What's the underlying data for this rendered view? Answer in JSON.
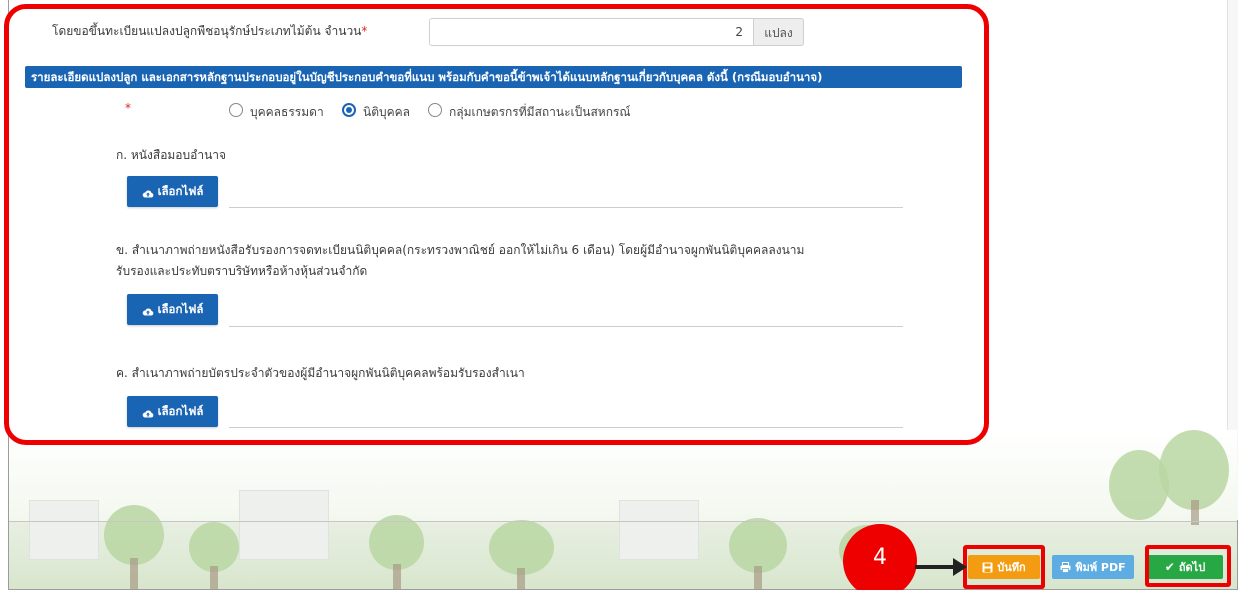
{
  "form": {
    "plot_count_label": "โดยขอขึ้นทะเบียนแปลงปลูกพืชอนุรักษ์ประเภทไม้ต้น จำนวน",
    "required_mark": "*",
    "plot_count_value": "2",
    "plot_count_unit": "แปลง",
    "info_banner": "รายละเอียดแปลงปลูก และเอกสารหลักฐานประกอบอยู่ในบัญชีประกอบคำขอที่แนบ พร้อมกับคำขอนี้ข้าพเจ้าได้แนบหลักฐานเกี่ยวกับบุคคล ดังนี้ (กรณีมอบอำนาจ)",
    "person_type": {
      "required_mark": "*",
      "options": [
        {
          "label": "บุคคลธรรมดา",
          "selected": false
        },
        {
          "label": "นิติบุคคล",
          "selected": true
        },
        {
          "label": "กลุ่มเกษตรกรที่มีสถานะเป็นสหกรณ์",
          "selected": false
        }
      ]
    },
    "docs": [
      {
        "title": "ก. หนังสือมอบอำนาจ",
        "title_line2": "",
        "button_label": "เลือกไฟล์"
      },
      {
        "title": "ข. สำเนาภาพถ่ายหนังสือรับรองการจดทะเบียนนิติบุคคล(กระทรวงพาณิชย์ ออกให้ไม่เกิน 6 เดือน) โดยผู้มีอำนาจผูกพันนิติบุคคลลงนาม",
        "title_line2": "รับรองและประทับตราบริษัทหรือห้างหุ้นส่วนจำกัด",
        "button_label": "เลือกไฟล์"
      },
      {
        "title": "ค. สำเนาภาพถ่ายบัตรประจำตัวของผู้มีอำนาจผูกพันนิติบุคคลพร้อมรับรองสำเนา",
        "title_line2": "",
        "button_label": "เลือกไฟล์"
      }
    ]
  },
  "actions": {
    "save_label": "บันทึก",
    "pdf_label": "พิมพ์ PDF",
    "next_label": "ถัดไป",
    "step_number": "4"
  },
  "colors": {
    "primary": "#1a64b4",
    "save": "#f39c12",
    "pdf": "#5dade2",
    "next": "#27a844",
    "annotation": "#ee0000"
  }
}
